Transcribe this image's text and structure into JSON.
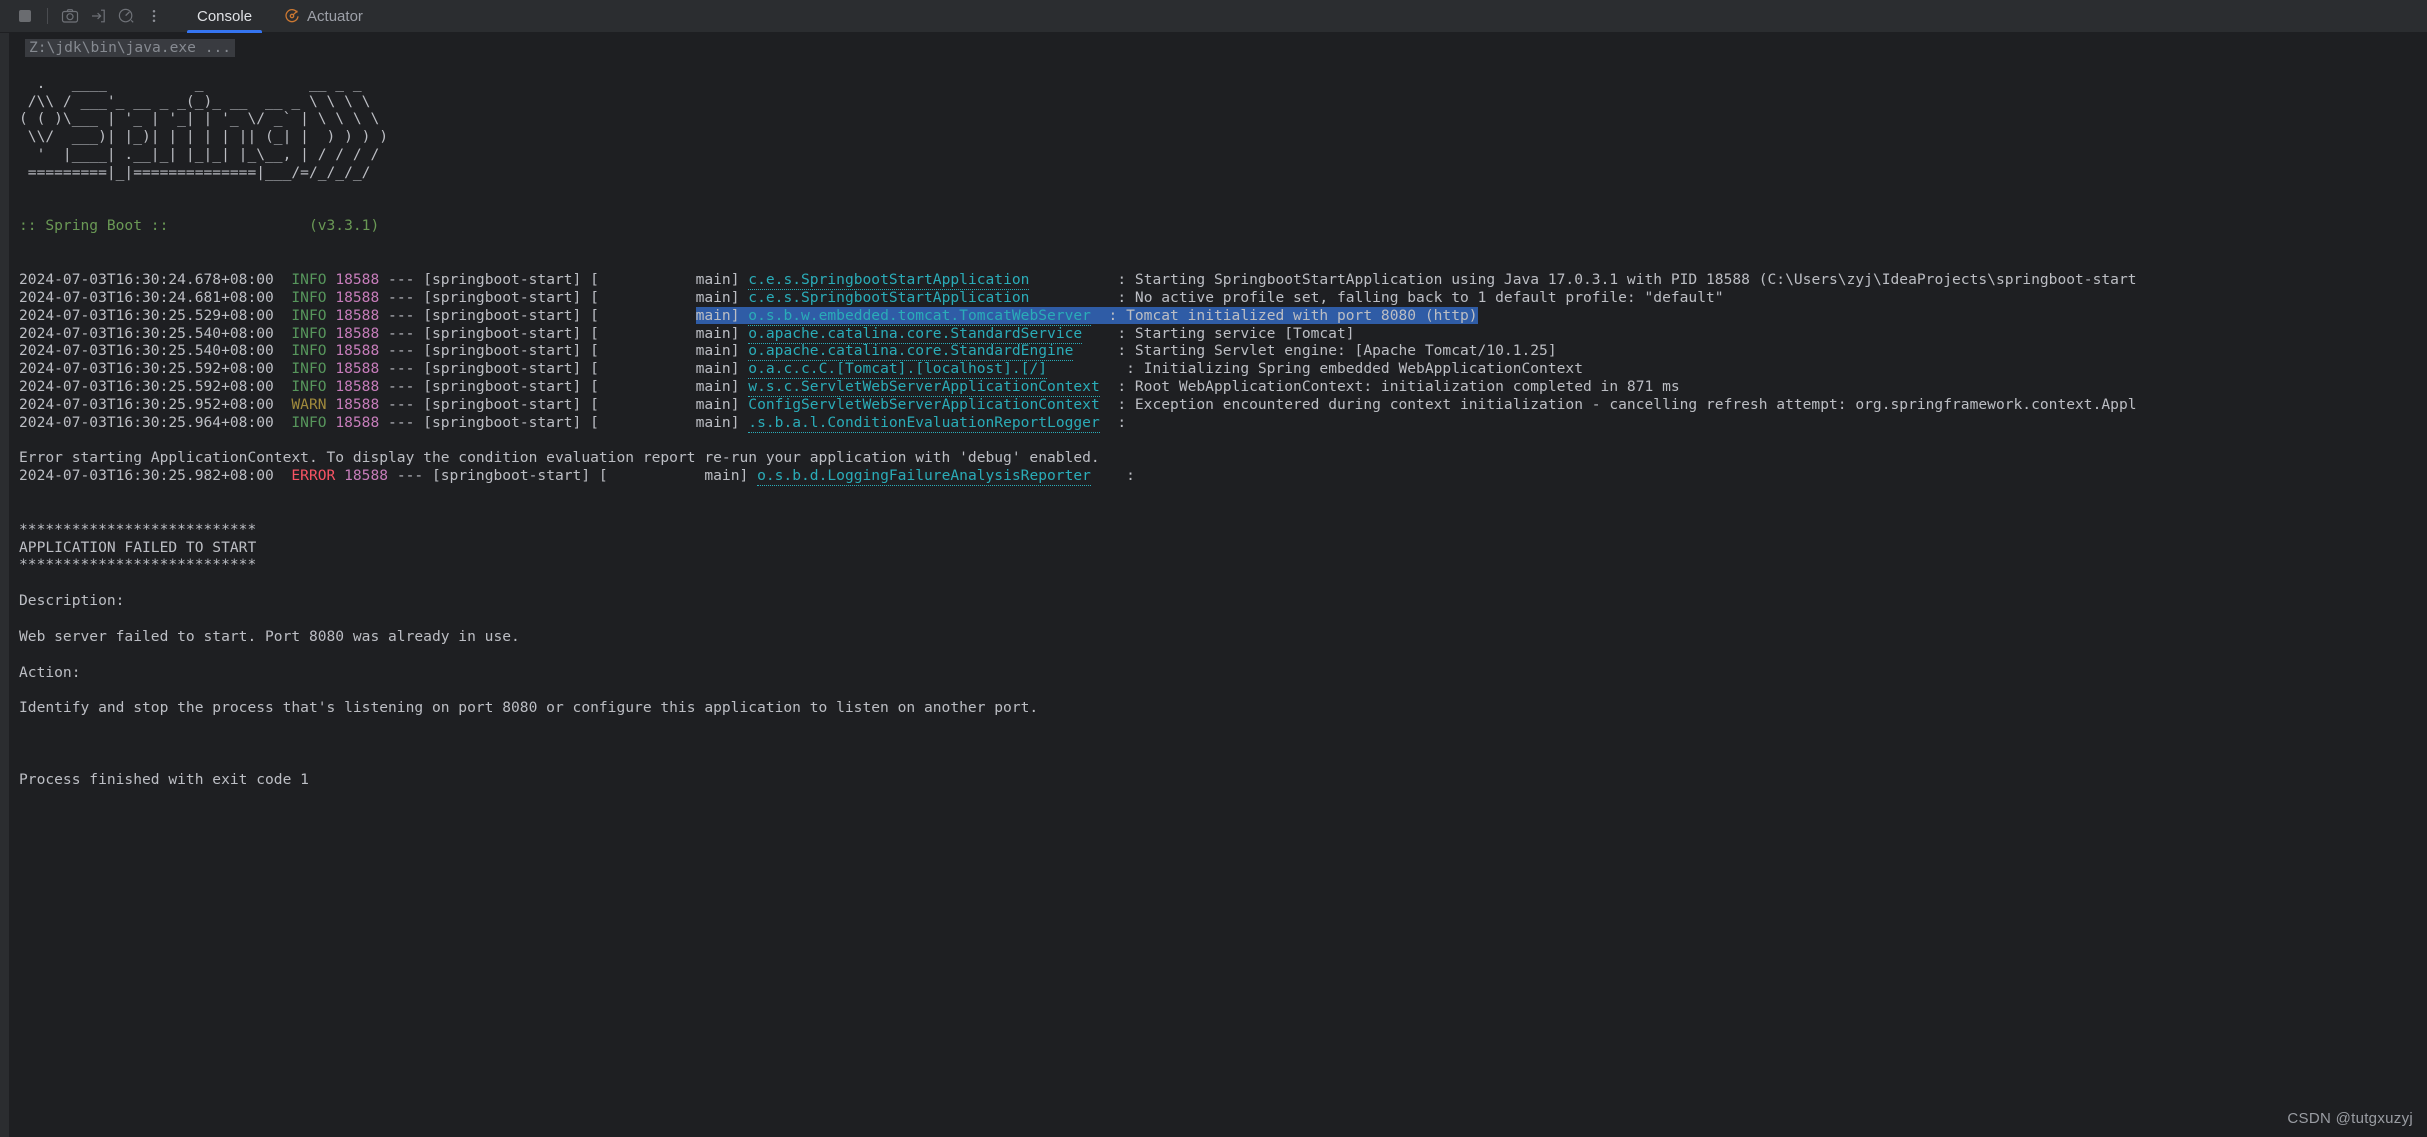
{
  "toolbar": {
    "icons": [
      {
        "name": "stop-icon",
        "glyph": "stop-square"
      },
      {
        "name": "camera-icon",
        "glyph": "camera"
      },
      {
        "name": "export-to-file-icon",
        "glyph": "arrow-into-box"
      },
      {
        "name": "gauge-icon",
        "glyph": "gauge"
      },
      {
        "name": "more-options-icon",
        "glyph": "vertical-ellipsis"
      }
    ],
    "tabs": [
      {
        "label": "Console",
        "active": true,
        "icon": null
      },
      {
        "label": "Actuator",
        "active": false,
        "icon": "actuator-icon"
      }
    ]
  },
  "console": {
    "command_line": "Z:\\jdk\\bin\\java.exe ...",
    "banner": [
      "",
      "  .   ____          _            __ _ _",
      " /\\\\ / ___'_ __ _ _(_)_ __  __ _ \\ \\ \\ \\",
      "( ( )\\___ | '_ | '_| | '_ \\/ _` | \\ \\ \\ \\",
      " \\\\/  ___)| |_)| | | | | || (_| |  ) ) ) )",
      "  '  |____| .__|_| |_|_| |_\\__, | / / / /",
      " =========|_|==============|___/=/_/_/_/",
      ""
    ],
    "banner_version_line": ":: Spring Boot ::                (v3.3.1)",
    "log_lines": [
      {
        "timestamp": "2024-07-03T16:30:24.678+08:00",
        "level": "INFO",
        "pid": "18588",
        "sep": " --- ",
        "app": "[springboot-start] [",
        "thread": "           main]",
        "logger": "c.e.s.SpringbootStartApplication",
        "logger_pad": "         ",
        "logger_link": true,
        "message": ": Starting SpringbootStartApplication using Java 17.0.3.1 with PID 18588 (C:\\Users\\zyj\\IdeaProjects\\springboot-start",
        "selected": false
      },
      {
        "timestamp": "2024-07-03T16:30:24.681+08:00",
        "level": "INFO",
        "pid": "18588",
        "sep": " --- ",
        "app": "[springboot-start] [",
        "thread": "           main]",
        "logger": "c.e.s.SpringbootStartApplication",
        "logger_pad": "         ",
        "logger_link": true,
        "message": ": No active profile set, falling back to 1 default profile: \"default\"",
        "selected": false
      },
      {
        "timestamp": "2024-07-03T16:30:25.529+08:00",
        "level": "INFO",
        "pid": "18588",
        "sep": " --- ",
        "app": "[springboot-start] [",
        "thread": "           main]",
        "logger": "o.s.b.w.embedded.tomcat.TomcatWebServer",
        "logger_pad": " ",
        "logger_link": true,
        "message": ": Tomcat initialized with port 8080 (http)",
        "selected": true
      },
      {
        "timestamp": "2024-07-03T16:30:25.540+08:00",
        "level": "INFO",
        "pid": "18588",
        "sep": " --- ",
        "app": "[springboot-start] [",
        "thread": "           main]",
        "logger": "o.apache.catalina.core.StandardService",
        "logger_pad": "   ",
        "logger_link": true,
        "message": ": Starting service [Tomcat]",
        "selected": false
      },
      {
        "timestamp": "2024-07-03T16:30:25.540+08:00",
        "level": "INFO",
        "pid": "18588",
        "sep": " --- ",
        "app": "[springboot-start] [",
        "thread": "           main]",
        "logger": "o.apache.catalina.core.StandardEngine",
        "logger_pad": "    ",
        "logger_link": true,
        "message": ": Starting Servlet engine: [Apache Tomcat/10.1.25]",
        "selected": false
      },
      {
        "timestamp": "2024-07-03T16:30:25.592+08:00",
        "level": "INFO",
        "pid": "18588",
        "sep": " --- ",
        "app": "[springboot-start] [",
        "thread": "           main]",
        "logger": "o.a.c.c.C.[Tomcat].[localhost].[/]",
        "logger_pad": "        ",
        "logger_link": true,
        "message": ": Initializing Spring embedded WebApplicationContext",
        "selected": false
      },
      {
        "timestamp": "2024-07-03T16:30:25.592+08:00",
        "level": "INFO",
        "pid": "18588",
        "sep": " --- ",
        "app": "[springboot-start] [",
        "thread": "           main]",
        "logger": "w.s.c.ServletWebServerApplicationContext",
        "logger_pad": " ",
        "logger_link": true,
        "message": ": Root WebApplicationContext: initialization completed in 871 ms",
        "selected": false
      },
      {
        "timestamp": "2024-07-03T16:30:25.952+08:00",
        "level": "WARN",
        "pid": "18588",
        "sep": " --- ",
        "app": "[springboot-start] [",
        "thread": "           main]",
        "logger": "ConfigServletWebServerApplicationContext",
        "logger_pad": " ",
        "logger_link": false,
        "message": ": Exception encountered during context initialization - cancelling refresh attempt: org.springframework.context.Appl",
        "selected": false
      },
      {
        "timestamp": "2024-07-03T16:30:25.964+08:00",
        "level": "INFO",
        "pid": "18588",
        "sep": " --- ",
        "app": "[springboot-start] [",
        "thread": "           main]",
        "logger": ".s.b.a.l.ConditionEvaluationReportLogger",
        "logger_pad": " ",
        "logger_link": true,
        "message": ":",
        "selected": false
      }
    ],
    "condition_report_hint": "Error starting ApplicationContext. To display the condition evaluation report re-run your application with 'debug' enabled.",
    "error_line": {
      "timestamp": "2024-07-03T16:30:25.982+08:00",
      "level": "ERROR",
      "pid": "18588",
      "sep": " --- ",
      "app": "[springboot-start] [",
      "thread": "           main]",
      "logger": "o.s.b.d.LoggingFailureAnalysisReporter",
      "logger_pad": "   ",
      "logger_link": true,
      "message": ":"
    },
    "failure_block": {
      "rule_top": "***************************",
      "heading": "APPLICATION FAILED TO START",
      "rule_bottom": "***************************",
      "description_label": "Description:",
      "description_text": "Web server failed to start. Port 8080 was already in use.",
      "action_label": "Action:",
      "action_text": "Identify and stop the process that's listening on port 8080 or configure this application to listen on another port."
    },
    "exit_line": "Process finished with exit code 1"
  },
  "watermark": "CSDN @tutgxuzyj",
  "colors": {
    "background": "#1e1f22",
    "toolbar_background": "#2b2d30",
    "accent_tab_underline": "#3574f0",
    "selection": "#2f5ca6",
    "info": "#57965c",
    "warn": "#a08a3c",
    "error": "#f75464",
    "pid": "#c77dbb",
    "logger": "#2aacb8",
    "text": "#bcbec4",
    "spring_green": "#6a9955",
    "actuator_icon": "#cc7832"
  }
}
